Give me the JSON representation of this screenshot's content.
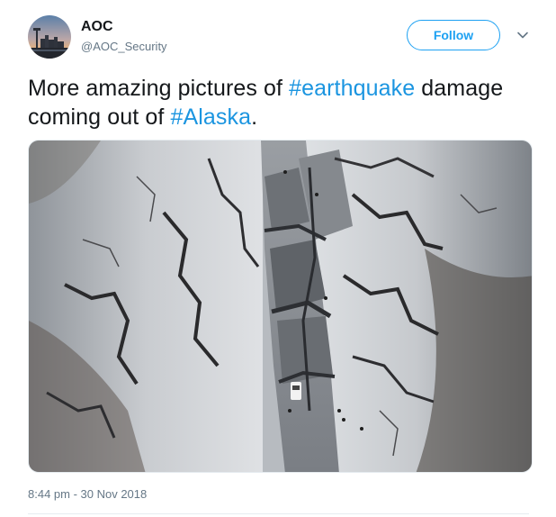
{
  "user": {
    "display_name": "AOC",
    "handle": "@AOC_Security",
    "avatar_icon": "city-skyline-avatar"
  },
  "actions": {
    "follow_label": "Follow",
    "more_icon": "chevron-down-icon"
  },
  "tweet": {
    "text_parts": [
      {
        "text": "More amazing pictures of ",
        "type": "plain"
      },
      {
        "text": "#earthquake",
        "type": "hashtag"
      },
      {
        "text": " damage coming out of ",
        "type": "plain"
      },
      {
        "text": "#Alaska",
        "type": "hashtag"
      },
      {
        "text": ".",
        "type": "plain"
      }
    ],
    "timestamp": "8:44 pm - 30 Nov 2018"
  },
  "colors": {
    "accent": "#1da1f2",
    "hashtag": "#1b95e0",
    "text": "#14171a",
    "muted": "#657786"
  }
}
